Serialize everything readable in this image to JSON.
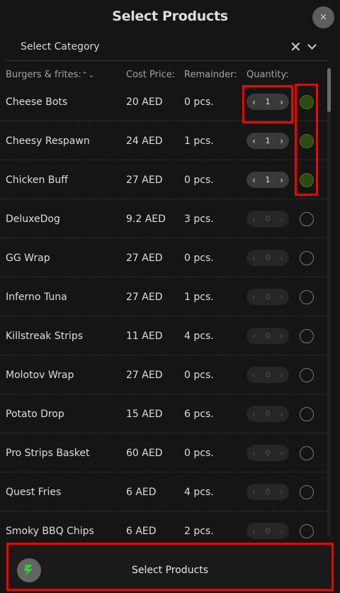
{
  "header": {
    "title": "Select Products",
    "close_icon": "×"
  },
  "category": {
    "label": "Select Category",
    "clear_icon": "✕"
  },
  "table": {
    "group_label": "Burgers & frites:",
    "sort_icon": "⌃⌄",
    "columns": {
      "cost": "Cost Price:",
      "remainder": "Remainder:",
      "quantity": "Quantity:"
    }
  },
  "products": [
    {
      "name": "Cheese Bots",
      "cost": "20 AED",
      "remainder": "0 pcs.",
      "qty": "1",
      "selected": true
    },
    {
      "name": "Cheesy Respawn",
      "cost": "24 AED",
      "remainder": "1 pcs.",
      "qty": "1",
      "selected": true
    },
    {
      "name": "Chicken Buff",
      "cost": "27 AED",
      "remainder": "0 pcs.",
      "qty": "1",
      "selected": true
    },
    {
      "name": "DeluxeDog",
      "cost": "9.2 AED",
      "remainder": "3 pcs.",
      "qty": "0",
      "selected": false
    },
    {
      "name": "GG Wrap",
      "cost": "27 AED",
      "remainder": "0 pcs.",
      "qty": "0",
      "selected": false
    },
    {
      "name": "Inferno Tuna",
      "cost": "27 AED",
      "remainder": "1 pcs.",
      "qty": "0",
      "selected": false
    },
    {
      "name": "Killstreak Strips",
      "cost": "11 AED",
      "remainder": "4 pcs.",
      "qty": "0",
      "selected": false
    },
    {
      "name": "Molotov Wrap",
      "cost": "27 AED",
      "remainder": "0 pcs.",
      "qty": "0",
      "selected": false
    },
    {
      "name": "Potato Drop",
      "cost": "15 AED",
      "remainder": "6 pcs.",
      "qty": "0",
      "selected": false
    },
    {
      "name": "Pro Strips Basket",
      "cost": "60 AED",
      "remainder": "0 pcs.",
      "qty": "0",
      "selected": false
    },
    {
      "name": "Quest Fries",
      "cost": "6 AED",
      "remainder": "4 pcs.",
      "qty": "0",
      "selected": false
    },
    {
      "name": "Smoky BBQ Chips",
      "cost": "6 AED",
      "remainder": "2 pcs.",
      "qty": "0",
      "selected": false
    }
  ],
  "footer": {
    "button_label": "Select Products",
    "icon": "bolt-icon"
  },
  "colors": {
    "highlight": "#ff0000",
    "selected_radio": "#2e4a14",
    "bolt": "#2bd42b"
  }
}
